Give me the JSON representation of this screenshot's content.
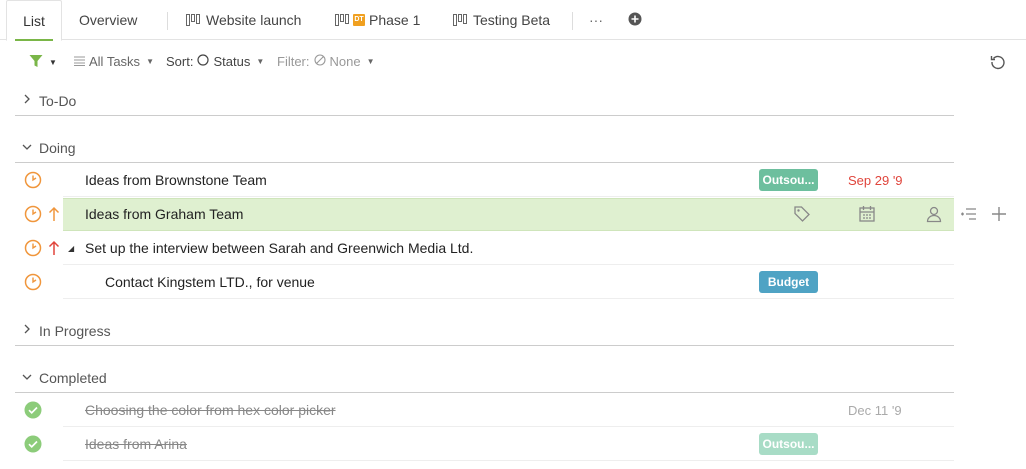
{
  "tabs": [
    {
      "label": "List",
      "active": true
    },
    {
      "label": "Overview"
    },
    {
      "label": "Website launch"
    },
    {
      "label": "Phase 1",
      "badge": "DT"
    },
    {
      "label": "Testing Beta"
    }
  ],
  "tabs_more": "···",
  "toolbar": {
    "view": "All Tasks",
    "sort_label": "Sort:",
    "sort_value": "Status",
    "filter_label": "Filter:",
    "filter_value": "None"
  },
  "sections": {
    "todo": "To-Do",
    "doing": "Doing",
    "in_progress": "In Progress",
    "completed": "Completed"
  },
  "tasks": {
    "t1": {
      "title": "Ideas from Brownstone Team",
      "tag": "Outsou...",
      "date": "Sep 29 '9"
    },
    "t2": {
      "title": "Ideas from Graham Team"
    },
    "t3": {
      "title": "Set up the interview between Sarah and Greenwich Media Ltd."
    },
    "t4": {
      "title": "Contact Kingstem LTD., for venue",
      "tag": "Budget"
    },
    "t5": {
      "title": "Choosing the color from hex color picker",
      "date": "Dec 11 '9"
    },
    "t6": {
      "title": "Ideas from Arina",
      "tag": "Outsou..."
    }
  },
  "colors": {
    "accent": "#7ab648",
    "overdue": "#e0453c",
    "tag_outsource": "#6dbf9e",
    "tag_budget": "#4fa3c4",
    "status_doing": "#f0963c",
    "status_done": "#8ccc7a",
    "priority_up_orange": "#f0963c",
    "priority_up_red": "#e0453c"
  }
}
